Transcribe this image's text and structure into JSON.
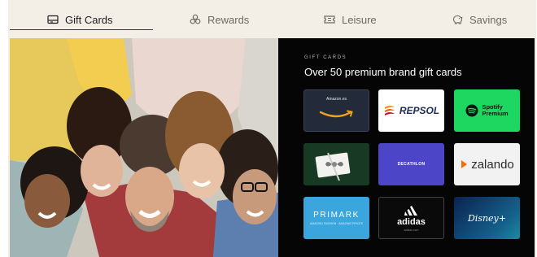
{
  "tabs": [
    {
      "label": "Gift Cards",
      "icon": "gift-card-icon",
      "active": true
    },
    {
      "label": "Rewards",
      "icon": "rewards-icon",
      "active": false
    },
    {
      "label": "Leisure",
      "icon": "ticket-icon",
      "active": false
    },
    {
      "label": "Savings",
      "icon": "piggy-bank-icon",
      "active": false
    }
  ],
  "hero": {
    "eyebrow": "GIFT CARDS",
    "headline": "Over 50 premium brand gift cards"
  },
  "brands": {
    "amazon": {
      "label": "Amazon.es",
      "logo": "amazon-smile-logo"
    },
    "repsol": {
      "label": "REPSOL",
      "logo": "repsol-flame-logo"
    },
    "spotify": {
      "label_1": "Spotify",
      "label_2": "Premium",
      "logo": "spotify-logo"
    },
    "gift": {
      "logo": "gift-card-ribbon"
    },
    "decathlon": {
      "label": "DECATHLON"
    },
    "zalando": {
      "label": "zalando",
      "logo": "zalando-logo"
    },
    "primark": {
      "label": "PRIMARK",
      "sub": "AMAZING FASHION · AMAZING PRICES"
    },
    "adidas": {
      "label": "adidas",
      "sub": "adidas.com",
      "logo": "adidas-logo"
    },
    "disney": {
      "label": "Disney+"
    }
  },
  "colors": {
    "tab_bg": "#f3efe6",
    "dark_panel": "#050505",
    "spotify_green": "#1ed760",
    "decathlon_blue": "#4c45c8",
    "primark_blue": "#3aa6dd"
  }
}
